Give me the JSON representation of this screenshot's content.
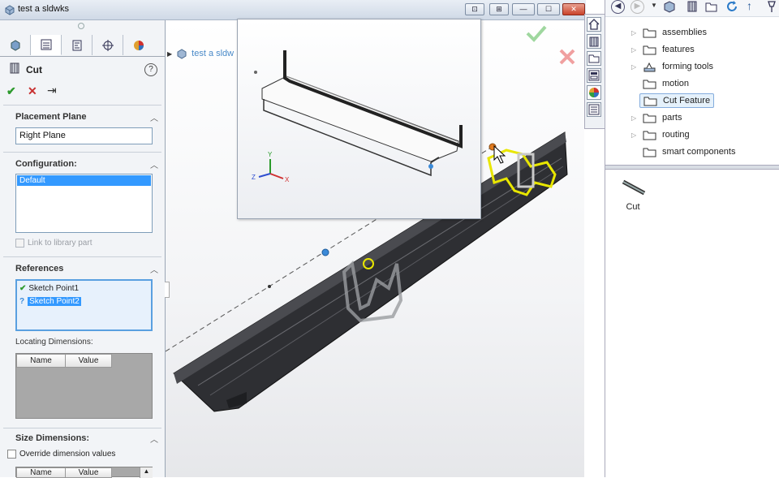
{
  "window": {
    "title": "test a sldwks",
    "breadcrumb": "test a sldw"
  },
  "property_manager": {
    "feature_name": "Cut",
    "help_icon": "help-icon",
    "placement_plane": {
      "label": "Placement Plane",
      "value": "Right Plane"
    },
    "configuration": {
      "label": "Configuration:",
      "items": [
        "Default"
      ],
      "link_label": "Link to library part"
    },
    "references": {
      "label": "References",
      "items": [
        {
          "status": "check",
          "label": "Sketch Point1"
        },
        {
          "status": "question",
          "label": "Sketch Point2"
        }
      ],
      "locating_label": "Locating Dimensions:",
      "columns": [
        "Name",
        "Value"
      ]
    },
    "size_dimensions": {
      "label": "Size Dimensions:",
      "override_label": "Override dimension values",
      "columns": [
        "Name",
        "Value"
      ]
    }
  },
  "design_library": {
    "folders": [
      {
        "label": "assemblies",
        "expandable": true
      },
      {
        "label": "features",
        "expandable": true
      },
      {
        "label": "forming tools",
        "expandable": true
      },
      {
        "label": "motion",
        "expandable": false
      },
      {
        "label": "Cut Feature",
        "expandable": false,
        "selected": true
      },
      {
        "label": "parts",
        "expandable": true
      },
      {
        "label": "routing",
        "expandable": true
      },
      {
        "label": "smart components",
        "expandable": false
      }
    ],
    "preview_item": "Cut"
  },
  "colors": {
    "accent": "#3399ff",
    "selection": "#3b8ad8",
    "highlight_yellow": "#e8e600"
  }
}
